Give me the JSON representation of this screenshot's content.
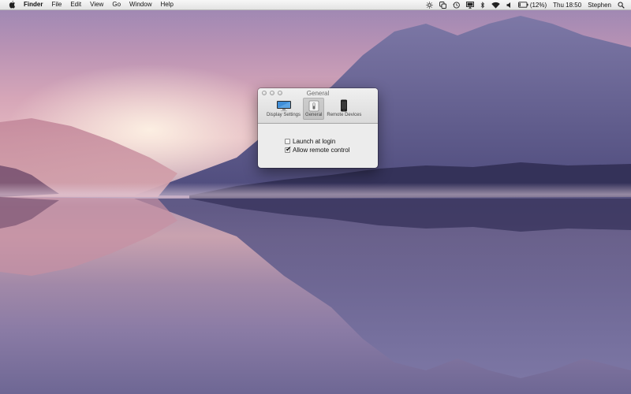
{
  "menubar": {
    "apple_icon": "apple-logo-icon",
    "app_name": "Finder",
    "menus": [
      "File",
      "Edit",
      "View",
      "Go",
      "Window",
      "Help"
    ],
    "status": {
      "battery_text": "(12%)",
      "clock": "Thu 18:50",
      "user": "Stephen",
      "icons": [
        "brightness-icon",
        "display-mirror-icon",
        "time-machine-icon",
        "airplay-display-icon",
        "bluetooth-icon",
        "wifi-icon",
        "volume-icon",
        "battery-icon",
        "spotlight-search-icon"
      ]
    }
  },
  "window": {
    "title": "General",
    "toolbar": [
      {
        "label": "Display Settings",
        "icon": "monitor-icon",
        "selected": false
      },
      {
        "label": "General",
        "icon": "general-switch-icon",
        "selected": true
      },
      {
        "label": "Remote Devices",
        "icon": "phone-icon",
        "selected": false
      }
    ],
    "options": [
      {
        "label": "Launch at login",
        "checked": false
      },
      {
        "label": "Allow remote control",
        "checked": true
      }
    ]
  },
  "colors": {
    "menubar_bg": "#e8e8e8",
    "window_bg": "#ececec",
    "wallpaper_sky": "#d6a6b8",
    "wallpaper_mountain": "#4d4a7a"
  }
}
